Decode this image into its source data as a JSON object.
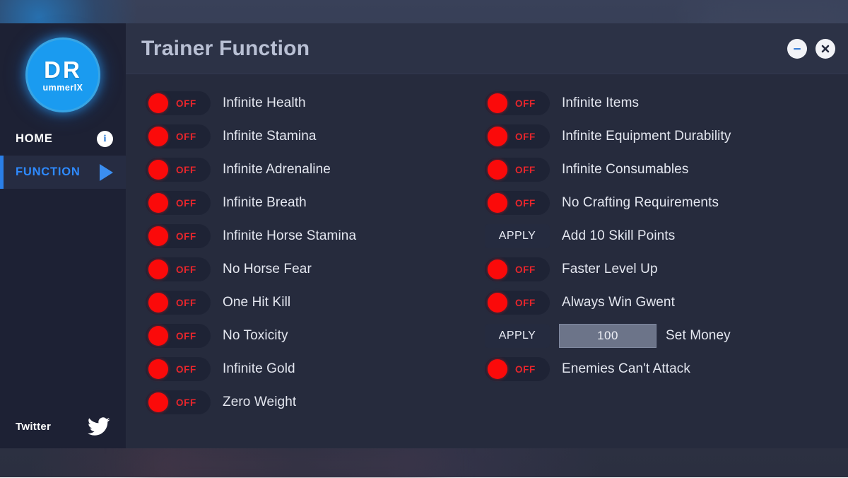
{
  "window": {
    "title": "Trainer Function",
    "minimize_icon": "minimize-icon",
    "close_icon": "close-icon"
  },
  "sidebar": {
    "logo": {
      "main_text": "DR",
      "sub_text": "ummerIX",
      "color": "#1a9bf0"
    },
    "nav": [
      {
        "label": "HOME",
        "active": false,
        "accessory": "info-icon"
      },
      {
        "label": "FUNCTION",
        "active": true,
        "accessory": "play-arrow-icon"
      }
    ],
    "social": {
      "label": "Twitter",
      "icon": "twitter-icon"
    }
  },
  "colors": {
    "accent_blue": "#2e8aff",
    "toggle_red": "#fb0a0a",
    "off_text_red": "#e8262c",
    "window_bg": "#262b3d",
    "sidebar_bg": "#1d2134",
    "titlebar_bg": "#2c3246",
    "title_text": "#b9c0d4"
  },
  "labels": {
    "off": "OFF",
    "apply": "APPLY"
  },
  "functions": {
    "left_column": [
      {
        "control": "toggle",
        "state": "OFF",
        "label": "Infinite Health"
      },
      {
        "control": "toggle",
        "state": "OFF",
        "label": "Infinite Stamina"
      },
      {
        "control": "toggle",
        "state": "OFF",
        "label": "Infinite Adrenaline"
      },
      {
        "control": "toggle",
        "state": "OFF",
        "label": "Infinite Breath"
      },
      {
        "control": "toggle",
        "state": "OFF",
        "label": "Infinite Horse Stamina"
      },
      {
        "control": "toggle",
        "state": "OFF",
        "label": "No Horse Fear"
      },
      {
        "control": "toggle",
        "state": "OFF",
        "label": "One Hit Kill"
      },
      {
        "control": "toggle",
        "state": "OFF",
        "label": "No Toxicity"
      },
      {
        "control": "toggle",
        "state": "OFF",
        "label": "Infinite Gold"
      },
      {
        "control": "toggle",
        "state": "OFF",
        "label": "Zero Weight"
      }
    ],
    "right_column": [
      {
        "control": "toggle",
        "state": "OFF",
        "label": "Infinite Items"
      },
      {
        "control": "toggle",
        "state": "OFF",
        "label": "Infinite Equipment Durability"
      },
      {
        "control": "toggle",
        "state": "OFF",
        "label": "Infinite Consumables"
      },
      {
        "control": "toggle",
        "state": "OFF",
        "label": "No Crafting Requirements"
      },
      {
        "control": "apply",
        "state": "APPLY",
        "label": "Add 10 Skill Points"
      },
      {
        "control": "toggle",
        "state": "OFF",
        "label": "Faster Level Up"
      },
      {
        "control": "toggle",
        "state": "OFF",
        "label": "Always Win Gwent"
      },
      {
        "control": "apply-input",
        "state": "APPLY",
        "value": "100",
        "label": "Set Money"
      },
      {
        "control": "toggle",
        "state": "OFF",
        "label": "Enemies Can't Attack"
      }
    ]
  }
}
